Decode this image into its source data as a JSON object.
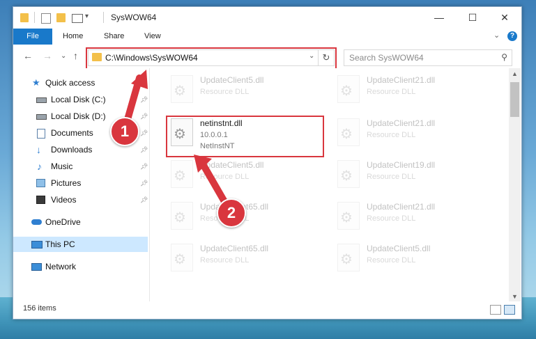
{
  "window": {
    "title": "SysWOW64",
    "controls": {
      "minimize": "—",
      "maximize": "☐",
      "close": "✕"
    }
  },
  "ribbon": {
    "file": "File",
    "tabs": [
      "Home",
      "Share",
      "View"
    ],
    "expand": "⌄",
    "help": "?"
  },
  "nav": {
    "back": "←",
    "forward": "→",
    "recent": "⌄",
    "up": "↑",
    "address": "C:\\Windows\\SysWOW64",
    "address_dropdown": "⌄",
    "refresh": "↻",
    "search_placeholder": "Search SysWOW64",
    "search_icon": "⚲"
  },
  "sidebar": {
    "items": [
      {
        "label": "Quick access",
        "icon": "star-icon",
        "pinned": false
      },
      {
        "label": "Local Disk (C:)",
        "icon": "drive-icon",
        "pinned": true
      },
      {
        "label": "Local Disk (D:)",
        "icon": "drive-icon",
        "pinned": true
      },
      {
        "label": "Documents",
        "icon": "documents-icon",
        "pinned": true
      },
      {
        "label": "Downloads",
        "icon": "download-icon",
        "pinned": true
      },
      {
        "label": "Music",
        "icon": "music-icon",
        "pinned": true
      },
      {
        "label": "Pictures",
        "icon": "pictures-icon",
        "pinned": true
      },
      {
        "label": "Videos",
        "icon": "videos-icon",
        "pinned": true
      },
      {
        "label": "OneDrive",
        "icon": "cloud-icon",
        "pinned": false
      },
      {
        "label": "This PC",
        "icon": "computer-icon",
        "pinned": false,
        "selected": true
      },
      {
        "label": "Network",
        "icon": "network-icon",
        "pinned": false
      }
    ]
  },
  "files": [
    {
      "name": "UpdateClient5.dll",
      "line2": "Resource DLL",
      "line3": "",
      "faded": true
    },
    {
      "name": "UpdateClient21.dll",
      "line2": "Resource DLL",
      "line3": "",
      "faded": true
    },
    {
      "name": "netinstnt.dll",
      "line2": "10.0.0.1",
      "line3": "NetInstNT",
      "faded": false
    },
    {
      "name": "UpdateClient21.dll",
      "line2": "Resource DLL",
      "line3": "",
      "faded": true
    },
    {
      "name": "UpdateClient5.dll",
      "line2": "Resource DLL",
      "line3": "",
      "faded": true
    },
    {
      "name": "UpdateClient19.dll",
      "line2": "Resource DLL",
      "line3": "",
      "faded": true
    },
    {
      "name": "UpdateClient65.dll",
      "line2": "Resource DLL",
      "line3": "",
      "faded": true
    },
    {
      "name": "UpdateClient21.dll",
      "line2": "Resource DLL",
      "line3": "",
      "faded": true
    },
    {
      "name": "UpdateClient65.dll",
      "line2": "Resource DLL",
      "line3": "",
      "faded": true
    },
    {
      "name": "UpdateClient5.dll",
      "line2": "Resource DLL",
      "line3": "",
      "faded": true
    }
  ],
  "status": {
    "item_count": "156 items"
  },
  "callouts": {
    "step1": "1",
    "step2": "2",
    "color": "#d9363e"
  }
}
